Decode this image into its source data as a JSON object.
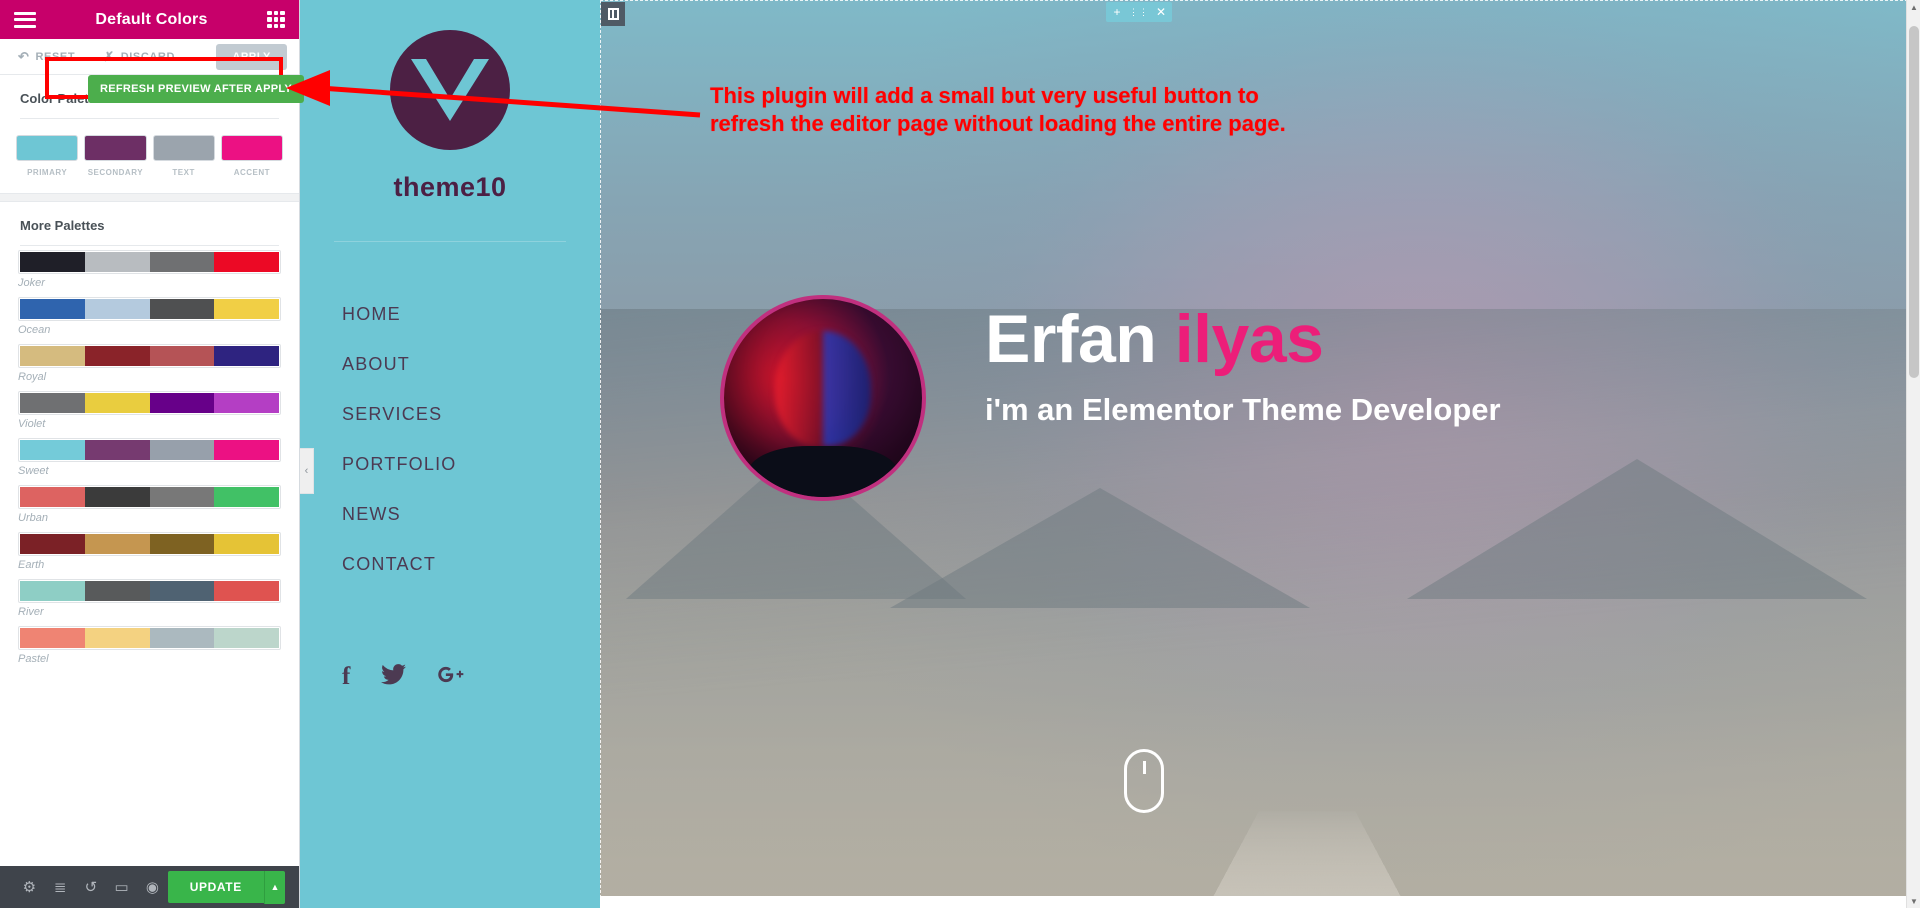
{
  "panel": {
    "header": {
      "title": "Default Colors",
      "menu_icon": "hamburger-icon",
      "apps_icon": "grid-icon"
    },
    "actions": {
      "reset_label": "RESET",
      "discard_label": "DISCARD",
      "apply_label": "APPLY"
    },
    "color_palette": {
      "title": "Color Palette",
      "swatches": [
        {
          "label": "PRIMARY",
          "color": "#6ec6d4"
        },
        {
          "label": "SECONDARY",
          "color": "#6d2f65"
        },
        {
          "label": "TEXT",
          "color": "#9ba4ad"
        },
        {
          "label": "ACCENT",
          "color": "#ec1183"
        }
      ]
    },
    "more_palettes": {
      "title": "More Palettes",
      "items": [
        {
          "name": "Joker",
          "colors": [
            "#1f1f28",
            "#b8bcc0",
            "#6f7072",
            "#ec0925"
          ]
        },
        {
          "name": "Ocean",
          "colors": [
            "#2f64ae",
            "#b4cade",
            "#4f5051",
            "#f1cf45"
          ]
        },
        {
          "name": "Royal",
          "colors": [
            "#d5bb7f",
            "#8a2329",
            "#b55356",
            "#2e2380"
          ]
        },
        {
          "name": "Violet",
          "colors": [
            "#6f7072",
            "#e9cd3f",
            "#670089",
            "#b43ec4"
          ]
        },
        {
          "name": "Sweet",
          "colors": [
            "#74cbd9",
            "#763a70",
            "#97a0ab",
            "#ec1183"
          ]
        },
        {
          "name": "Urban",
          "colors": [
            "#dd6361",
            "#3b3b3b",
            "#787878",
            "#41c166"
          ]
        },
        {
          "name": "Earth",
          "colors": [
            "#7b2126",
            "#c59650",
            "#7e6222",
            "#e5c336"
          ]
        },
        {
          "name": "River",
          "colors": [
            "#8ecec5",
            "#585a5b",
            "#4f6272",
            "#df5350"
          ]
        },
        {
          "name": "Pastel",
          "colors": [
            "#ef8473",
            "#f4d281",
            "#abb9bf",
            "#bcd6cb"
          ]
        }
      ]
    },
    "footer": {
      "icons": [
        {
          "name": "settings-icon",
          "glyph": "⚙"
        },
        {
          "name": "layers-icon",
          "glyph": "≣"
        },
        {
          "name": "history-icon",
          "glyph": "↺"
        },
        {
          "name": "responsive-icon",
          "glyph": "▭"
        },
        {
          "name": "preview-icon",
          "glyph": "◉"
        }
      ],
      "update_label": "UPDATE",
      "caret_glyph": "▲"
    }
  },
  "annotation": {
    "refresh_button_label": "REFRESH PREVIEW AFTER APPLY",
    "note_line1": "This plugin will add a small but very useful button to",
    "note_line2": "refresh the editor page without loading the entire page.",
    "highlight_color": "#ff0000",
    "button_color": "#4cae4c"
  },
  "preview": {
    "section_toolbar": {
      "add_glyph": "+",
      "grip_glyph": "⋮⋮",
      "close_glyph": "✕"
    },
    "column_handle_name": "column-handle",
    "collapse_tab_glyph": "‹",
    "site": {
      "logo_text": "theme10",
      "nav": [
        "HOME",
        "ABOUT",
        "SERVICES",
        "PORTFOLIO",
        "NEWS",
        "CONTACT"
      ],
      "socials": [
        {
          "name": "facebook-icon",
          "glyph": "f"
        },
        {
          "name": "twitter-icon",
          "glyph": "🐦"
        },
        {
          "name": "google-plus-icon",
          "glyph": "G+"
        }
      ],
      "hero": {
        "title_white": "Erfan ",
        "title_pink": "ilyas",
        "subtitle": "i'm an Elementor Theme Developer",
        "accent_color": "#ec1e79",
        "primary_color": "#6ec6d4"
      }
    }
  }
}
